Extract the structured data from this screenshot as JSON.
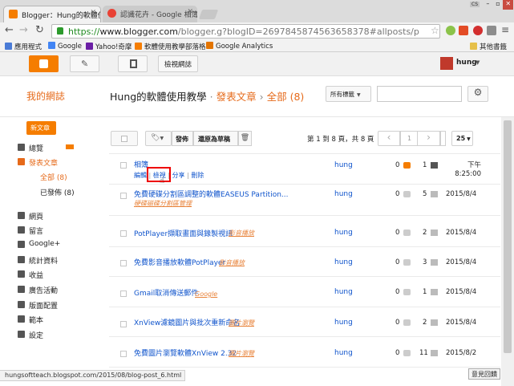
{
  "browser": {
    "tabs": [
      {
        "title": "Blogger：Hung的軟體使",
        "active": true
      },
      {
        "title": "認識花卉 - Google 相簿",
        "active": false
      }
    ],
    "url_prefix": "https://",
    "url_host": "www.blogger.com",
    "url_path": "/blogger.g?blogID=2697845874563658378#allposts/p",
    "window_label": "CS",
    "bookmarks": [
      {
        "label": "應用程式",
        "color": "#4a7bd6"
      },
      {
        "label": "Google",
        "color": "#4285f4"
      },
      {
        "label": "Yahoo!奇摩",
        "color": "#6b1fa5"
      },
      {
        "label": "軟體使用教學部落格",
        "color": "#f57d00"
      },
      {
        "label": "Google Analytics",
        "color": "#e37400"
      }
    ],
    "other_bookmarks": "其他書籤"
  },
  "header": {
    "view_blog": "檢視網誌",
    "user": "hung"
  },
  "titlebar": {
    "my_blogs": "我的網誌",
    "blog_name": "Hung的軟體使用教學",
    "sep": "·",
    "section": "發表文章",
    "arrow": "›",
    "filter": "全部 (8)",
    "labels_dropdown": "所有標籤"
  },
  "sidebar": {
    "new_post": "新文章",
    "items": [
      {
        "label": "總覽"
      },
      {
        "label": "發表文章",
        "active": true
      },
      {
        "label": "全部 (8)",
        "sub": true,
        "active": true
      },
      {
        "label": "已發佈 (8)",
        "sub": true
      },
      {
        "label": "網頁"
      },
      {
        "label": "留言"
      },
      {
        "label": "Google+"
      },
      {
        "label": "統計資料"
      },
      {
        "label": "收益"
      },
      {
        "label": "廣告活動"
      },
      {
        "label": "版面配置"
      },
      {
        "label": "範本"
      },
      {
        "label": "設定"
      }
    ]
  },
  "toolbar": {
    "publish": "發佈",
    "revert_draft": "還原為草稿",
    "paging": "第 1 到 8 頁，共 8 頁",
    "page": "1",
    "per_page": "25"
  },
  "posts": [
    {
      "title": "相簿",
      "label": "",
      "author": "hung",
      "comments": "0",
      "views": "1",
      "date": "下午 8:25:00",
      "actions": [
        "編輯",
        "檢視",
        "分享",
        "刪除"
      ]
    },
    {
      "title": "免費硬碟分割區調整的軟體EASEUS Partition...",
      "label": "硬碟磁碟分割區管理",
      "author": "hung",
      "comments": "0",
      "views": "5",
      "date": "2015/8/4"
    },
    {
      "title": "PotPlayer擷取畫面與錄製視訊",
      "label": "影音播放",
      "author": "hung",
      "comments": "0",
      "views": "2",
      "date": "2015/8/4"
    },
    {
      "title": "免費影音播放軟體PotPlayer",
      "label": "影音播放",
      "author": "hung",
      "comments": "0",
      "views": "3",
      "date": "2015/8/4"
    },
    {
      "title": "Gmail取消傳送郵件",
      "label": "Google",
      "author": "hung",
      "comments": "0",
      "views": "1",
      "date": "2015/8/4"
    },
    {
      "title": "XnView濾鏡圖片與批次重新命名",
      "label": "圖片瀏覽",
      "author": "hung",
      "comments": "0",
      "views": "2",
      "date": "2015/8/4"
    },
    {
      "title": "免費圖片瀏覽軟體XnView 2.32",
      "label": "圖片瀏覽",
      "author": "hung",
      "comments": "0",
      "views": "11",
      "date": "2015/8/2"
    }
  ],
  "status_url": "hungsofttеach.blogspot.com/2015/08/blog-post_6.html",
  "feedback": "意見回饋"
}
